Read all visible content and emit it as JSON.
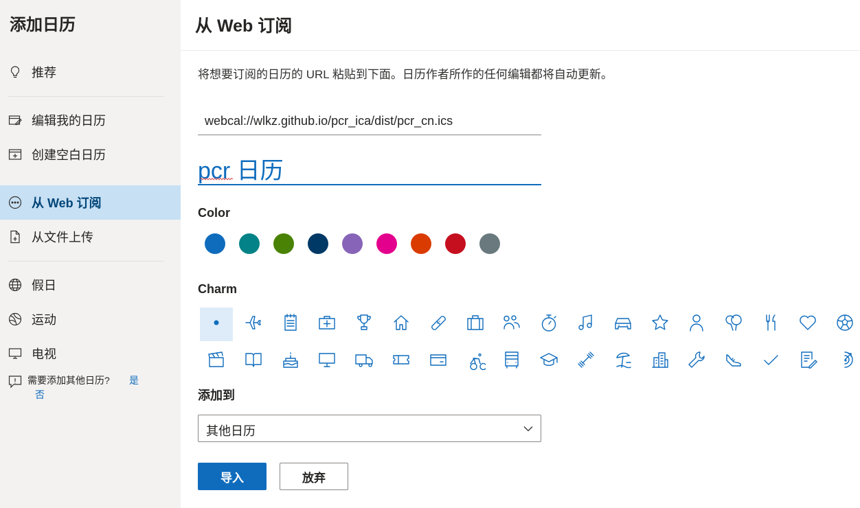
{
  "sidebar": {
    "title": "添加日历",
    "items": [
      {
        "label": "推荐",
        "icon": "lightbulb-icon"
      },
      {
        "label": "编辑我的日历",
        "icon": "edit-calendar-icon"
      },
      {
        "label": "创建空白日历",
        "icon": "add-calendar-icon"
      },
      {
        "label": "从 Web 订阅",
        "icon": "web-subscribe-icon",
        "active": true
      },
      {
        "label": "从文件上传",
        "icon": "file-upload-icon"
      },
      {
        "label": "假日",
        "icon": "globe-icon"
      },
      {
        "label": "运动",
        "icon": "sports-ball-icon"
      },
      {
        "label": "电视",
        "icon": "tv-icon"
      }
    ],
    "help": {
      "text": "需要添加其他日历?",
      "yes": "是",
      "no": "否",
      "icon": "feedback-icon"
    }
  },
  "main": {
    "title": "从 Web 订阅",
    "instructions": "将想要订阅的日历的 URL 粘贴到下面。日历作者所作的任何编辑都将自动更新。",
    "url_value": "webcal://wlkz.github.io/pcr_ica/dist/pcr_cn.ics",
    "name_value": "pcr 日历",
    "color_label": "Color",
    "colors": [
      "#0f6cbd",
      "#038387",
      "#498205",
      "#003966",
      "#8764b8",
      "#e3008c",
      "#da3b01",
      "#c50f1f",
      "#69797e"
    ],
    "charm_label": "Charm",
    "charms": [
      "dot-icon",
      "airplane-icon",
      "notepad-icon",
      "first-aid-kit-icon",
      "trophy-icon",
      "home-icon",
      "bandage-icon",
      "briefcase-icon",
      "people-icon",
      "stopwatch-icon",
      "music-note-icon",
      "car-icon",
      "star-icon",
      "person-icon",
      "balloons-icon",
      "utensils-icon",
      "heart-icon",
      "soccer-ball-icon",
      "clapperboard-icon",
      "book-icon",
      "birthday-cake-icon",
      "monitor-icon",
      "truck-icon",
      "ticket-icon",
      "credit-card-icon",
      "bicycle-icon",
      "bus-icon",
      "graduation-cap-icon",
      "dumbbell-icon",
      "beach-icon",
      "city-icon",
      "wrench-icon",
      "sneaker-icon",
      "checkmark-icon",
      "edit-document-icon",
      "target-icon"
    ],
    "add_to_label": "添加到",
    "add_to_value": "其他日历",
    "import_label": "导入",
    "discard_label": "放弃"
  }
}
